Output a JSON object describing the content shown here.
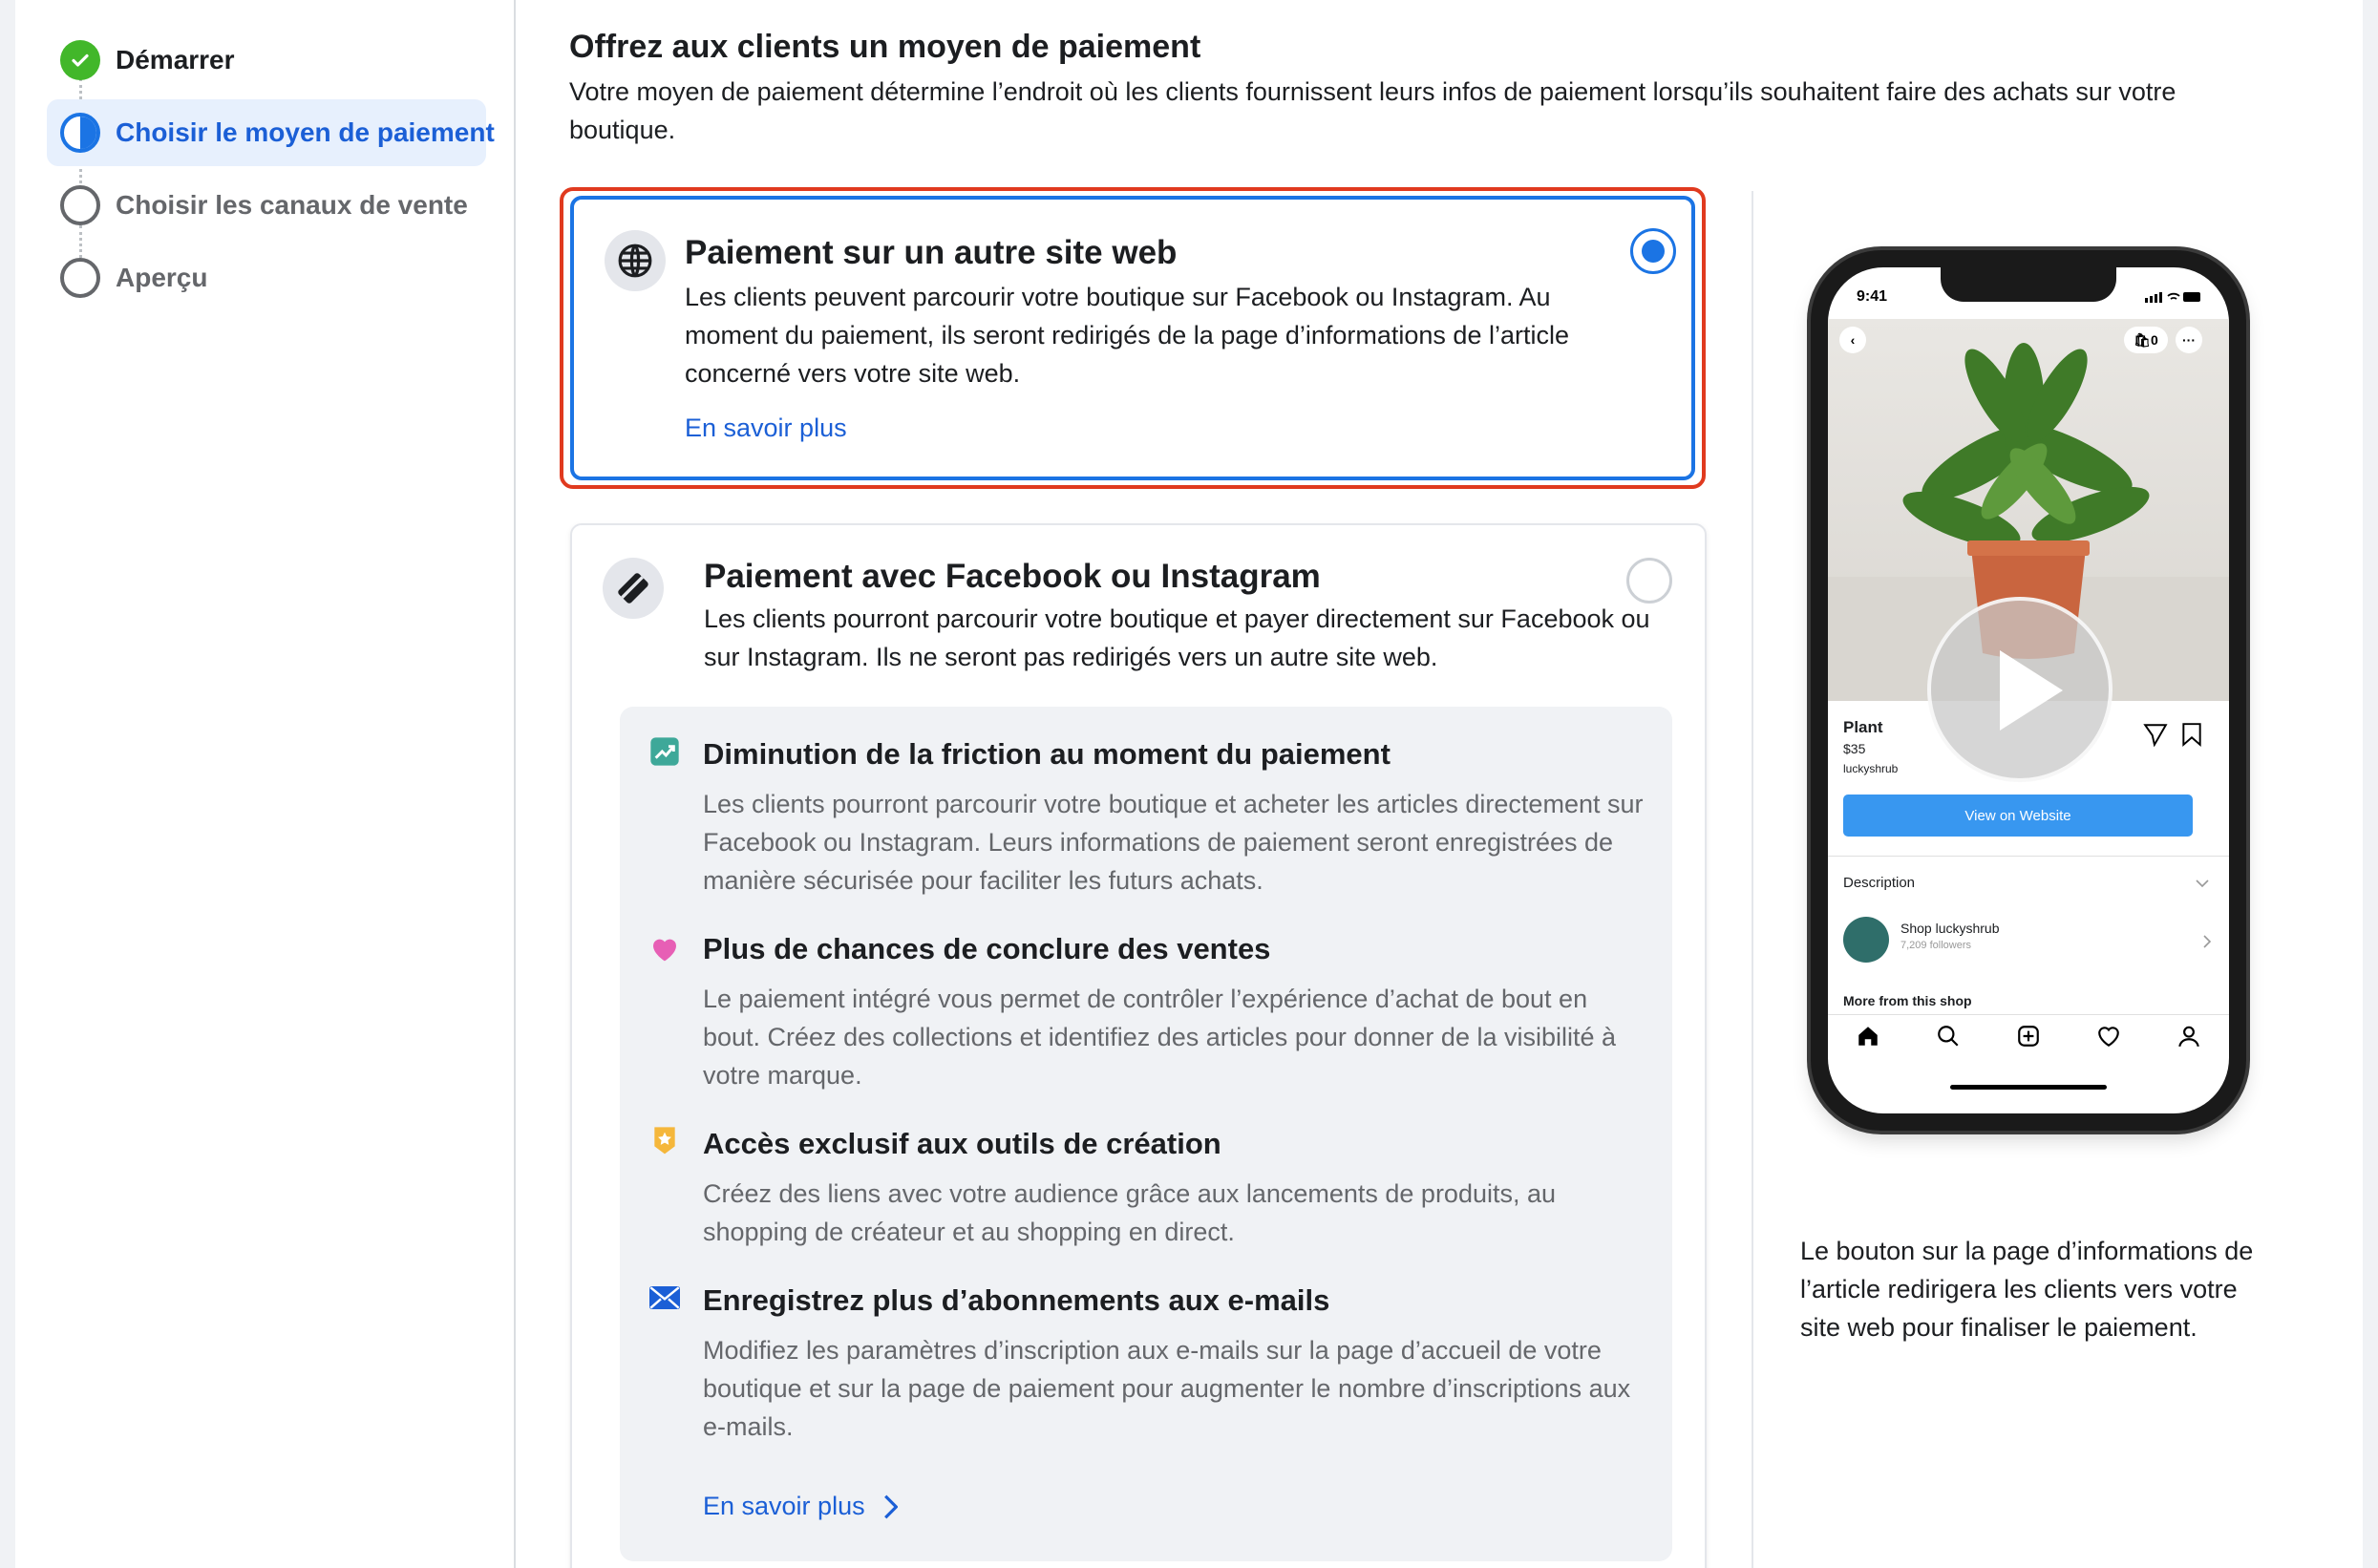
{
  "stepper": {
    "steps": [
      {
        "label": "Démarrer",
        "state": "completed"
      },
      {
        "label": "Choisir le moyen de paiement",
        "state": "current"
      },
      {
        "label": "Choisir les canaux de vente",
        "state": "pending"
      },
      {
        "label": "Aperçu",
        "state": "pending"
      }
    ]
  },
  "main": {
    "title": "Offrez aux clients un moyen de paiement",
    "description": "Votre moyen de paiement détermine l’endroit où les clients fournissent leurs infos de paiement lorsqu’ils souhaitent faire des achats sur votre boutique."
  },
  "options": [
    {
      "icon": "globe-icon",
      "title": "Paiement sur un autre site web",
      "description": "Les clients peuvent parcourir votre boutique sur Facebook ou Instagram. Au moment du paiement, ils seront redirigés de la page d’informations de l’article concerné vers votre site web.",
      "link": "En savoir plus",
      "selected": true
    },
    {
      "icon": "card-icon",
      "title": "Paiement avec Facebook ou Instagram",
      "description": "Les clients pourront parcourir votre boutique et payer directement sur Facebook ou sur Instagram. Ils ne seront pas redirigés vers un autre site web.",
      "selected": false,
      "benefits": [
        {
          "icon": "trend-up-icon",
          "title": "Diminution de la friction au moment du paiement",
          "description": "Les clients pourront parcourir votre boutique et acheter les articles directement sur Facebook ou Instagram. Leurs informations de paiement seront enregistrées de manière sécurisée pour faciliter les futurs achats."
        },
        {
          "icon": "heart-icon",
          "title": "Plus de chances de conclure des ventes",
          "description": "Le paiement intégré vous permet de contrôler l’expérience d’achat de bout en bout. Créez des collections et identifiez des articles pour donner de la visibilité à votre marque."
        },
        {
          "icon": "star-badge-icon",
          "title": "Accès exclusif aux outils de création",
          "description": "Créez des liens avec votre audience grâce aux lancements de produits, au shopping de créateur et au shopping en direct."
        },
        {
          "icon": "envelope-icon",
          "title": "Enregistrez plus d’abonnements aux e-mails",
          "description": "Modifiez les paramètres d’inscription aux e-mails sur la page d’accueil de votre boutique et sur la page de paiement pour augmenter le nombre d’inscriptions aux e-mails."
        }
      ],
      "link": "En savoir plus"
    }
  ],
  "preview": {
    "phone": {
      "time": "9:41",
      "cart_count": "0",
      "product_name": "Plant",
      "price": "$35",
      "shop_handle": "luckyshrub",
      "button": "View on Website",
      "description_label": "Description",
      "shop_name": "Shop luckyshrub",
      "followers": "7,209 followers",
      "more_label": "More from this shop"
    },
    "caption": "Le bouton sur la page d’informations de l’article redirigera les clients vers votre site web pour finaliser le paiement."
  },
  "colors": {
    "accent": "#1b74e4",
    "success": "#42b72a",
    "highlight_border": "#e03a1f",
    "benefit_bg": "#f0f2f5"
  }
}
